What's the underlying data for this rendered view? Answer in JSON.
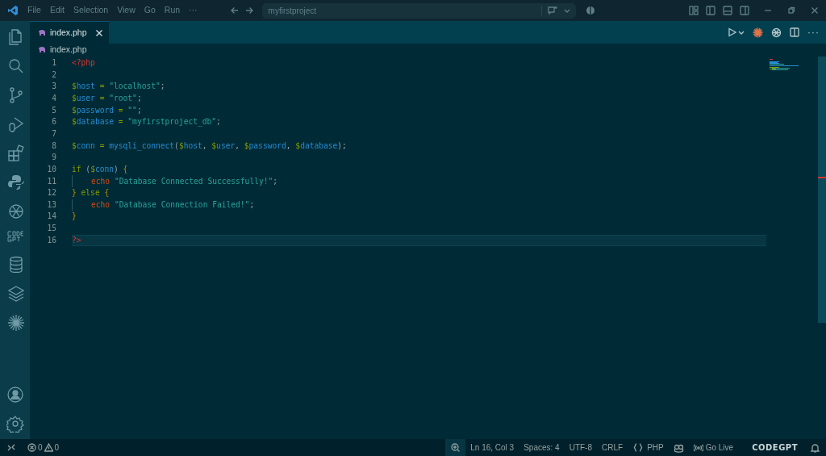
{
  "title_bar": {
    "menus": [
      "File",
      "Edit",
      "Selection",
      "View",
      "Go",
      "Run",
      "···"
    ],
    "search": {
      "value": "myfirstproject"
    }
  },
  "tabs": [
    {
      "label": "index.php",
      "selected": true
    }
  ],
  "breadcrumb": "index.php",
  "editor": {
    "lines": [
      {
        "number": "1",
        "current": false,
        "indented": false,
        "tokens": [
          {
            "kind": "tag",
            "text": "<?php"
          }
        ]
      },
      {
        "number": "2",
        "current": false,
        "indented": false
      },
      {
        "number": "3",
        "current": false,
        "indented": false,
        "tokens": [
          {
            "kind": "sigil",
            "text": "$"
          },
          {
            "kind": "var",
            "text": "host"
          },
          {
            "kind": "op",
            "text": " = "
          },
          {
            "kind": "string",
            "text": "\"localhost\""
          },
          {
            "kind": "plain",
            "text": ";"
          }
        ]
      },
      {
        "number": "4",
        "current": false,
        "indented": false,
        "tokens": [
          {
            "kind": "sigil",
            "text": "$"
          },
          {
            "kind": "var",
            "text": "user"
          },
          {
            "kind": "op",
            "text": " = "
          },
          {
            "kind": "string",
            "text": "\"root\""
          },
          {
            "kind": "plain",
            "text": ";"
          }
        ]
      },
      {
        "number": "5",
        "current": false,
        "indented": false,
        "tokens": [
          {
            "kind": "sigil",
            "text": "$"
          },
          {
            "kind": "var",
            "text": "password"
          },
          {
            "kind": "op",
            "text": " = "
          },
          {
            "kind": "string",
            "text": "\"\""
          },
          {
            "kind": "plain",
            "text": ";"
          }
        ]
      },
      {
        "number": "6",
        "current": false,
        "indented": false,
        "tokens": [
          {
            "kind": "sigil",
            "text": "$"
          },
          {
            "kind": "var",
            "text": "database"
          },
          {
            "kind": "op",
            "text": " = "
          },
          {
            "kind": "string",
            "text": "\"myfirstproject_db\""
          },
          {
            "kind": "plain",
            "text": ";"
          }
        ]
      },
      {
        "number": "7",
        "current": false,
        "indented": false
      },
      {
        "number": "8",
        "current": false,
        "indented": false,
        "tokens": [
          {
            "kind": "sigil",
            "text": "$"
          },
          {
            "kind": "var",
            "text": "conn"
          },
          {
            "kind": "op",
            "text": " = "
          },
          {
            "kind": "func",
            "text": "mysqli_connect"
          },
          {
            "kind": "plain",
            "text": "("
          },
          {
            "kind": "sigil",
            "text": "$"
          },
          {
            "kind": "var",
            "text": "host"
          },
          {
            "kind": "plain",
            "text": ", "
          },
          {
            "kind": "sigil",
            "text": "$"
          },
          {
            "kind": "var",
            "text": "user"
          },
          {
            "kind": "plain",
            "text": ", "
          },
          {
            "kind": "sigil",
            "text": "$"
          },
          {
            "kind": "var",
            "text": "password"
          },
          {
            "kind": "plain",
            "text": ", "
          },
          {
            "kind": "sigil",
            "text": "$"
          },
          {
            "kind": "var",
            "text": "database"
          },
          {
            "kind": "plain",
            "text": ");"
          }
        ]
      },
      {
        "number": "9",
        "current": false,
        "indented": false
      },
      {
        "number": "10",
        "current": false,
        "indented": false,
        "tokens": [
          {
            "kind": "keyword",
            "text": "if"
          },
          {
            "kind": "plain",
            "text": " ("
          },
          {
            "kind": "sigil",
            "text": "$"
          },
          {
            "kind": "var",
            "text": "conn"
          },
          {
            "kind": "plain",
            "text": ") "
          },
          {
            "kind": "brace",
            "text": "{"
          }
        ]
      },
      {
        "number": "11",
        "current": false,
        "indented": true,
        "tokens": [
          {
            "kind": "echo",
            "text": "echo"
          },
          {
            "kind": "string",
            "text": " \"Database Connected Successfully!\""
          },
          {
            "kind": "plain",
            "text": ";"
          }
        ]
      },
      {
        "number": "12",
        "current": false,
        "indented": false,
        "tokens": [
          {
            "kind": "brace",
            "text": "}"
          },
          {
            "kind": "keyword",
            "text": " else"
          },
          {
            "kind": "brace",
            "text": " {"
          }
        ]
      },
      {
        "number": "13",
        "current": false,
        "indented": true,
        "tokens": [
          {
            "kind": "echo",
            "text": "echo"
          },
          {
            "kind": "string",
            "text": " \"Database Connection Failed!\""
          },
          {
            "kind": "plain",
            "text": ";"
          }
        ]
      },
      {
        "number": "14",
        "current": false,
        "indented": false,
        "tokens": [
          {
            "kind": "brace",
            "text": "}"
          }
        ]
      },
      {
        "number": "15",
        "current": false,
        "indented": false
      },
      {
        "number": "16",
        "current": true,
        "indented": false,
        "tokens": [
          {
            "kind": "tag",
            "text": "?>"
          }
        ]
      }
    ]
  },
  "status_bar": {
    "errors": "0",
    "warnings": "0",
    "items": [
      "Ln 16, Col 3",
      "Spaces: 4",
      "UTF-8",
      "CRLF",
      "PHP",
      "Go Live"
    ],
    "brand": "CODEGPT"
  }
}
